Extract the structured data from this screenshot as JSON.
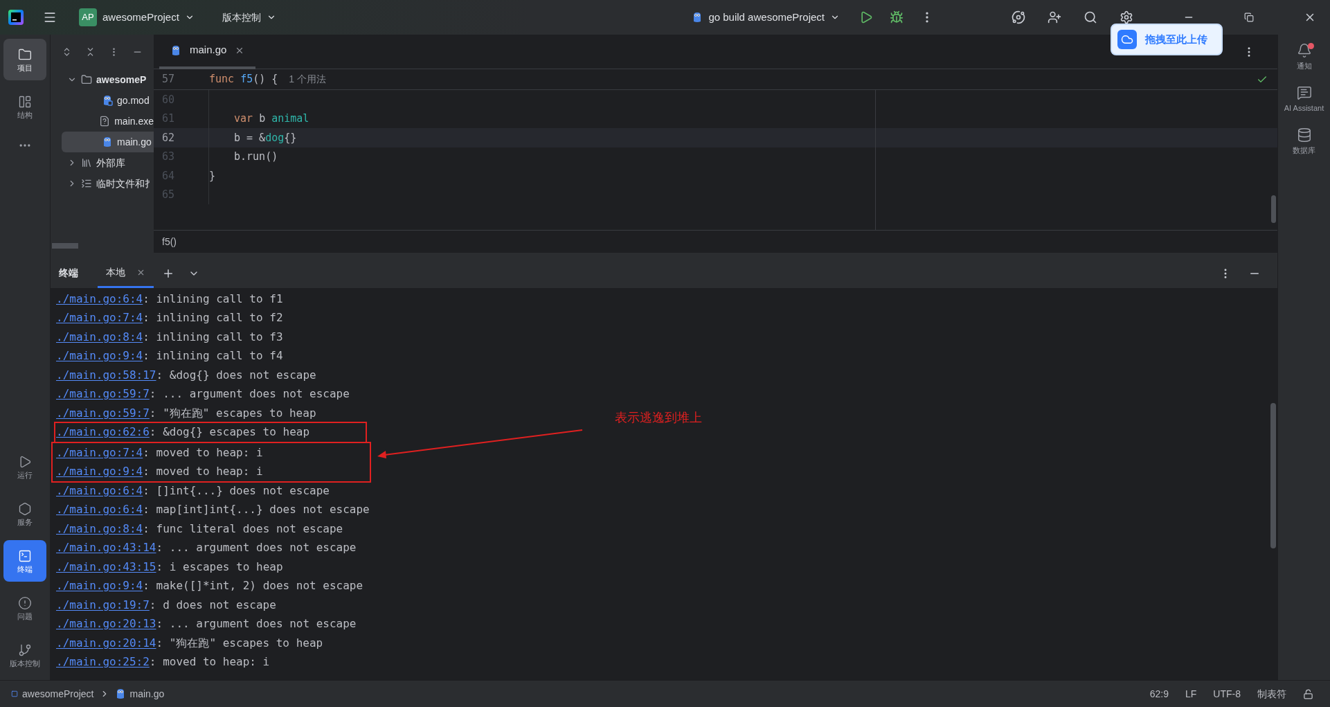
{
  "title_bar": {
    "project_badge": "AP",
    "project": "awesomeProject",
    "vcs": "版本控制",
    "run_config": "go build awesomeProject"
  },
  "upload_popup": {
    "label": "拖拽至此上传"
  },
  "left_toolbar": {
    "top": [
      {
        "label": "项目",
        "kind": "folder",
        "selected": true
      },
      {
        "label": "结构",
        "kind": "structure",
        "selected": false
      }
    ],
    "bottom": [
      {
        "label": "运行",
        "kind": "run",
        "selected": false
      },
      {
        "label": "服务",
        "kind": "services",
        "selected": false
      },
      {
        "label": "终端",
        "kind": "terminal",
        "selected": true
      },
      {
        "label": "问题",
        "kind": "problems",
        "selected": false
      },
      {
        "label": "版本控制",
        "kind": "vcs",
        "selected": false
      }
    ]
  },
  "project_tree": [
    {
      "label": "awesomeP",
      "kind": "folder",
      "expanded": true,
      "selected": false,
      "children": [
        {
          "label": "go.mod",
          "kind": "gomod",
          "selected": false
        },
        {
          "label": "main.exe",
          "kind": "unknown",
          "selected": false
        },
        {
          "label": "main.go",
          "kind": "go",
          "selected": true
        }
      ]
    },
    {
      "label": "外部库",
      "kind": "library",
      "expanded": false,
      "selected": false
    },
    {
      "label": "临时文件和扌",
      "kind": "scratch",
      "expanded": false,
      "selected": false
    }
  ],
  "editor": {
    "tabs": [
      {
        "label": "main.go",
        "selected": true
      }
    ],
    "sticky": {
      "number": "57",
      "tokens": [
        {
          "text": "func ",
          "kind": "kw"
        },
        {
          "text": "f5",
          "kind": "fn"
        },
        {
          "text": "() {",
          "kind": "plain"
        }
      ],
      "hint": "1 个用法"
    },
    "lines": [
      {
        "number": "60",
        "current": false
      },
      {
        "number": "61",
        "current": false,
        "indented": true,
        "tokens": [
          {
            "text": "var ",
            "kind": "kw"
          },
          {
            "text": "b ",
            "kind": "plain"
          },
          {
            "text": "animal",
            "kind": "type"
          }
        ]
      },
      {
        "number": "62",
        "current": true,
        "indented": true,
        "tokens": [
          {
            "text": "b = &",
            "kind": "plain"
          },
          {
            "text": "dog",
            "kind": "type"
          },
          {
            "text": "{}",
            "kind": "plain"
          }
        ]
      },
      {
        "number": "63",
        "current": false,
        "indented": true,
        "tokens": [
          {
            "text": "b.run()",
            "kind": "plain"
          }
        ]
      },
      {
        "number": "64",
        "current": false,
        "indented": false,
        "tokens": [
          {
            "text": "}",
            "kind": "plain"
          }
        ]
      },
      {
        "number": "65",
        "current": false
      }
    ],
    "breadcrumb": "f5()"
  },
  "terminal": {
    "title": "终端",
    "tabs": [
      {
        "label": "本地",
        "selected": true
      }
    ],
    "lines": [
      {
        "kind": "line",
        "link": "./main.go:6:4",
        "text": ": inlining call to f1"
      },
      {
        "kind": "line",
        "link": "./main.go:7:4",
        "text": ": inlining call to f2"
      },
      {
        "kind": "line",
        "link": "./main.go:8:4",
        "text": ": inlining call to f3"
      },
      {
        "kind": "line",
        "link": "./main.go:9:4",
        "text": ": inlining call to f4"
      },
      {
        "kind": "line",
        "link": "./main.go:58:17",
        "text": ": &dog{} does not escape"
      },
      {
        "kind": "line",
        "link": "./main.go:59:7",
        "text": ": ... argument does not escape"
      },
      {
        "kind": "line",
        "link": "./main.go:59:7",
        "text": ": \"狗在跑\" escapes to heap"
      },
      {
        "kind": "highlight",
        "lines": [
          {
            "link": "./main.go:62:6",
            "text": ": &dog{} escapes to heap"
          }
        ]
      },
      {
        "kind": "highlight",
        "lines": [
          {
            "link": "./main.go:7:4",
            "text": ": moved to heap: i"
          },
          {
            "link": "./main.go:9:4",
            "text": ": moved to heap: i"
          }
        ]
      },
      {
        "kind": "line",
        "link": "./main.go:6:4",
        "text": ": []int{...} does not escape"
      },
      {
        "kind": "line",
        "link": "./main.go:6:4",
        "text": ": map[int]int{...} does not escape"
      },
      {
        "kind": "line",
        "link": "./main.go:8:4",
        "text": ": func literal does not escape"
      },
      {
        "kind": "line",
        "link": "./main.go:43:14",
        "text": ": ... argument does not escape"
      },
      {
        "kind": "line",
        "link": "./main.go:43:15",
        "text": ": i escapes to heap"
      },
      {
        "kind": "line",
        "link": "./main.go:9:4",
        "text": ": make([]*int, 2) does not escape"
      },
      {
        "kind": "line",
        "link": "./main.go:19:7",
        "text": ": d does not escape"
      },
      {
        "kind": "line",
        "link": "./main.go:20:13",
        "text": ": ... argument does not escape"
      },
      {
        "kind": "line",
        "link": "./main.go:20:14",
        "text": ": \"狗在跑\" escapes to heap"
      },
      {
        "kind": "line",
        "link": "./main.go:25:2",
        "text": ": moved to heap: i"
      }
    ]
  },
  "annotation": {
    "text": "表示逃逸到堆上"
  },
  "right_toolbar": [
    {
      "label": "通知",
      "kind": "bell",
      "badge": true
    },
    {
      "label": "AI Assistant",
      "kind": "ai",
      "badge": false
    },
    {
      "label": "数据库",
      "kind": "database",
      "badge": false
    }
  ],
  "status_bar": {
    "path": [
      "awesomeProject",
      "main.go"
    ],
    "items": [
      "62:9",
      "LF",
      "UTF-8",
      "制表符"
    ]
  }
}
